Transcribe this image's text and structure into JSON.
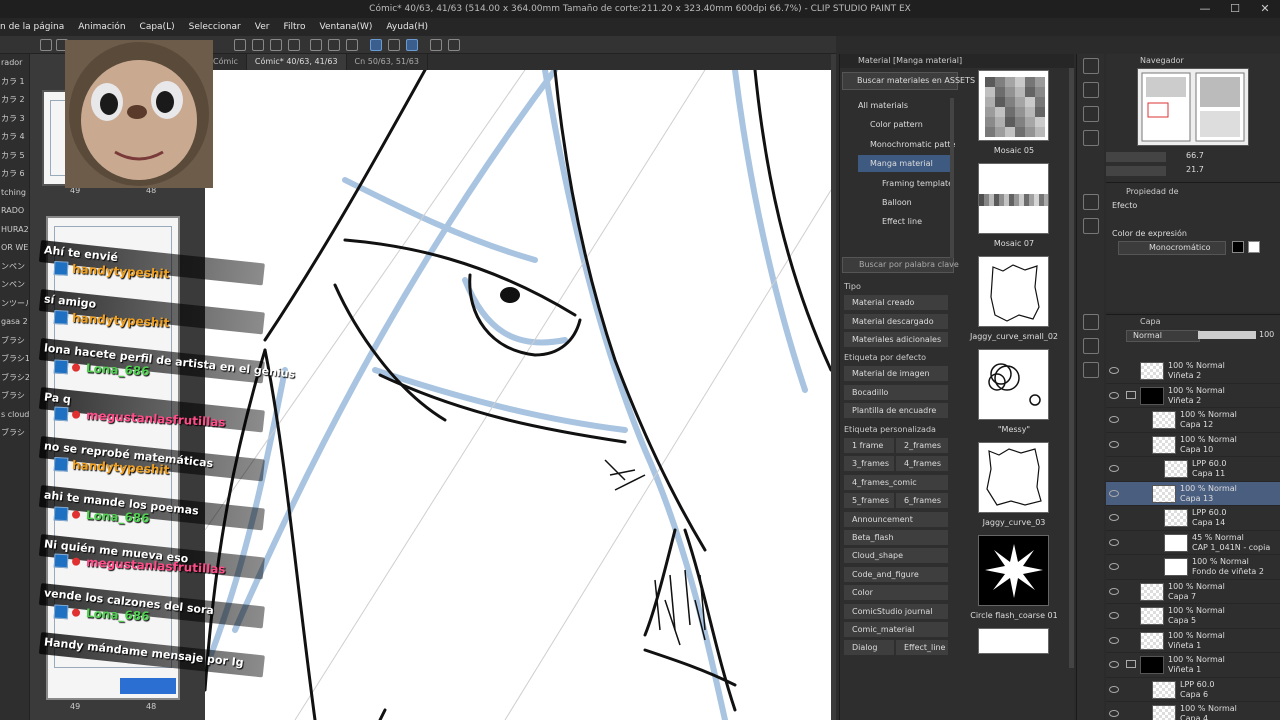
{
  "window": {
    "title": "Cómic* 40/63, 41/63 (514.00 x 364.00mm Tamaño de corte:211.20 x 323.40mm 600dpi 66.7%) - CLIP STUDIO PAINT EX",
    "minimize": "—",
    "maximize": "☐",
    "close": "✕"
  },
  "menu": [
    "n de la página",
    "Animación",
    "Capa(L)",
    "Seleccionar",
    "Ver",
    "Filtro",
    "Ventana(W)",
    "Ayuda(H)"
  ],
  "left_strip": [
    "rador",
    "カラ 1",
    "カラ 2",
    "カラ 3",
    "カラ 4",
    "カラ 5",
    "カラ 6",
    "tching",
    "RADO",
    "HURA2",
    "OR WE",
    "ンペン",
    "ンペン",
    "ンツール",
    "gasa 2",
    "ブラシ",
    "ブラシ1",
    "ブラシ2",
    "ブラシ",
    "s cloud",
    "ブラシ"
  ],
  "doc_tabs": [
    {
      "label": "Cómic",
      "active": false
    },
    {
      "label": "Cómic* 40/63, 41/63",
      "active": true
    },
    {
      "label": "Cn 50/63, 51/63",
      "active": false
    }
  ],
  "pages": {
    "top_labels": [
      "49",
      "48"
    ],
    "bottom_labels": [
      "49",
      "48"
    ]
  },
  "chat": {
    "lines": [
      {
        "text": "Ahí te envié"
      },
      {
        "user": "handytypeshit",
        "color": "#f0a020",
        "badge": true,
        "dot": false
      },
      {
        "text": "sí amigo"
      },
      {
        "user": "handytypeshit",
        "color": "#f0a020",
        "badge": true,
        "dot": false
      },
      {
        "text": "lona hacete perfil de artista en el genius"
      },
      {
        "user": "Lona_686",
        "color": "#50d050",
        "badge": true,
        "dot": true
      },
      {
        "text": "Pa q"
      },
      {
        "user": "megustanlasfrutillas",
        "color": "#ff4d8a",
        "badge": true,
        "dot": true
      },
      {
        "text": "no se reprobé matemáticas"
      },
      {
        "user": "handytypeshit",
        "color": "#f0a020",
        "badge": true,
        "dot": false
      },
      {
        "text": "ahi te mande los poemas"
      },
      {
        "user": "Lona_686",
        "color": "#50d050",
        "badge": true,
        "dot": true
      },
      {
        "text": "Ni quién me mueva eso"
      },
      {
        "user": "megustanlasfrutillas",
        "color": "#ff4d8a",
        "badge": true,
        "dot": true
      },
      {
        "text": "vende los calzones del sora"
      },
      {
        "user": "Lona_686",
        "color": "#50d050",
        "badge": true,
        "dot": true
      },
      {
        "text": "Handy mándame mensaje por Ig"
      }
    ]
  },
  "material": {
    "header": "Material [Manga material]",
    "assets_button": "Buscar materiales en ASSETS",
    "tree": [
      {
        "label": "All materials",
        "indent": 0,
        "selected": false
      },
      {
        "label": "Color pattern",
        "indent": 1,
        "selected": false
      },
      {
        "label": "Monochromatic patte",
        "indent": 1,
        "selected": false
      },
      {
        "label": "Manga material",
        "indent": 1,
        "selected": true
      },
      {
        "label": "Framing template",
        "indent": 2,
        "selected": false
      },
      {
        "label": "Balloon",
        "indent": 2,
        "selected": false
      },
      {
        "label": "Effect line",
        "indent": 2,
        "selected": false
      }
    ],
    "search_placeholder": "Buscar por palabra clave",
    "tipo_label": "Tipo",
    "tipo_items": [
      "Material creado",
      "Material descargado",
      "Materiales adicionales"
    ],
    "default_label": "Etiqueta por defecto",
    "default_items": [
      "Material de imagen",
      "Bocadillo",
      "Plantilla de encuadre"
    ],
    "custom_label": "Etiqueta personalizada",
    "custom_pairs": [
      [
        "1 frame",
        "2_frames"
      ],
      [
        "3_frames",
        "4_frames"
      ],
      [
        "4_frames_comic",
        ""
      ],
      [
        "5_frames",
        "6_frames"
      ],
      [
        "Announcement",
        ""
      ],
      [
        "Beta_flash",
        ""
      ],
      [
        "Cloud_shape",
        ""
      ],
      [
        "Code_and_figure",
        ""
      ],
      [
        "Color",
        ""
      ],
      [
        "ComicStudio journal",
        ""
      ],
      [
        "Comic_material",
        ""
      ],
      [
        "Dialog",
        "Effect_line"
      ]
    ],
    "thumbs": [
      {
        "label": "Mosaic 05"
      },
      {
        "label": "Mosaic 07"
      },
      {
        "label": "Jaggy_curve_small_02"
      },
      {
        "label": "\"Messy\""
      },
      {
        "label": "Jaggy_curve_03"
      },
      {
        "label": "Circle flash_coarse 01"
      }
    ]
  },
  "navigator": {
    "title": "Navegador",
    "zoom": "66.7",
    "rotate": "21.7"
  },
  "property": {
    "title": "Propiedad de",
    "effect_label": "Efecto",
    "expr_label": "Color de expresión",
    "expr_value": "Monocromático"
  },
  "layers": {
    "title": "Capa",
    "blend": "Normal",
    "opacity": "100",
    "items": [
      {
        "l1": "100 % Normal",
        "l2": "Viñeta 2",
        "indent": 0,
        "thumb": "checker",
        "selected": false
      },
      {
        "l1": "100 % Normal",
        "l2": "Viñeta 2",
        "indent": 0,
        "thumb": "black",
        "selected": false,
        "folder": true
      },
      {
        "l1": "100 % Normal",
        "l2": "Capa 12",
        "indent": 1,
        "thumb": "checker",
        "selected": false
      },
      {
        "l1": "100 % Normal",
        "l2": "Capa 10",
        "indent": 1,
        "thumb": "checker",
        "selected": false
      },
      {
        "l1": "LPP 60.0",
        "l2": "Capa 11",
        "indent": 2,
        "thumb": "checker",
        "selected": false
      },
      {
        "l1": "100 % Normal",
        "l2": "Capa 13",
        "indent": 1,
        "thumb": "checker",
        "selected": true
      },
      {
        "l1": "LPP 60.0",
        "l2": "Capa 14",
        "indent": 2,
        "thumb": "checker",
        "selected": false
      },
      {
        "l1": "45 % Normal",
        "l2": "CAP 1_041N - copia",
        "indent": 2,
        "thumb": "white",
        "selected": false
      },
      {
        "l1": "100 % Normal",
        "l2": "Fondo de viñeta 2",
        "indent": 2,
        "thumb": "white",
        "selected": false
      },
      {
        "l1": "100 % Normal",
        "l2": "Capa 7",
        "indent": 0,
        "thumb": "checker",
        "selected": false
      },
      {
        "l1": "100 % Normal",
        "l2": "Capa 5",
        "indent": 0,
        "thumb": "checker",
        "selected": false
      },
      {
        "l1": "100 % Normal",
        "l2": "Viñeta 1",
        "indent": 0,
        "thumb": "checker",
        "selected": false
      },
      {
        "l1": "100 % Normal",
        "l2": "Viñeta 1",
        "indent": 0,
        "thumb": "black",
        "selected": false,
        "folder": true
      },
      {
        "l1": "LPP 60.0",
        "l2": "Capa 6",
        "indent": 1,
        "thumb": "checker",
        "selected": false
      },
      {
        "l1": "100 % Normal",
        "l2": "Capa 4",
        "indent": 1,
        "thumb": "checker",
        "selected": false
      }
    ]
  }
}
